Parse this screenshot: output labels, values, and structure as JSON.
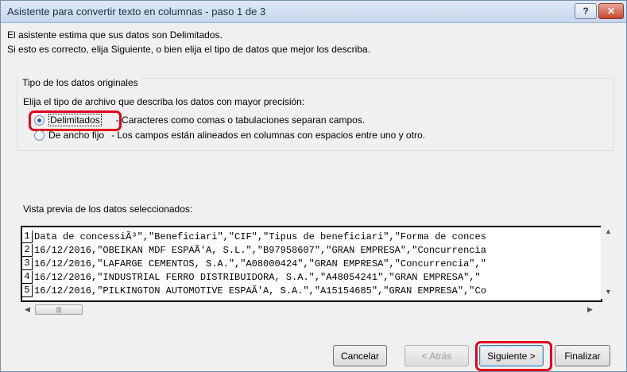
{
  "window": {
    "title": "Asistente para convertir texto en columnas - paso 1 de 3",
    "help_label": "?",
    "close_label": "✕"
  },
  "intro": {
    "line1": "El asistente estima que sus datos son Delimitados.",
    "line2": "Si esto es correcto, elija Siguiente, o bien elija el tipo de datos que mejor los describa."
  },
  "data_type": {
    "group_label": "Tipo de los datos originales",
    "instruction": "Elija el tipo de archivo que describa los datos con mayor precisión:",
    "options": [
      {
        "label": "Delimitados",
        "description": "- Caracteres como comas o tabulaciones separan campos.",
        "selected": true
      },
      {
        "label": "De ancho fijo",
        "description": "- Los campos están alineados en columnas con espacios entre uno y otro.",
        "selected": false
      }
    ]
  },
  "preview": {
    "label": "Vista previa de los datos seleccionados:",
    "rows": [
      {
        "num": "1",
        "text": "Data de concessiÃ³\",\"Beneficiari\",\"CIF\",\"Tipus de beneficiari\",\"Forma de conces"
      },
      {
        "num": "2",
        "text": "16/12/2016,\"OBEIKAN MDF ESPAÃ'A, S.L.\",\"B97958607\",\"GRAN EMPRESA\",\"Concurrencia"
      },
      {
        "num": "3",
        "text": "16/12/2016,\"LAFARGE CEMENTOS, S.A.\",\"A08000424\",\"GRAN EMPRESA\",\"Concurrencia\",\""
      },
      {
        "num": "4",
        "text": "16/12/2016,\"INDUSTRIAL FERRO DISTRIBUIDORA, S.A.\",\"A48054241\",\"GRAN EMPRESA\",\""
      },
      {
        "num": "5",
        "text": "16/12/2016,\"PILKINGTON AUTOMOTIVE ESPAÃ'A, S.A.\",\"A15154685\",\"GRAN EMPRESA\",\"Co"
      }
    ]
  },
  "buttons": {
    "cancel": "Cancelar",
    "back": "< Atrás",
    "next": "Siguiente >",
    "finish": "Finalizar"
  },
  "icons": {
    "scroll_up": "up-arrow-icon",
    "scroll_down": "down-arrow-icon",
    "scroll_left": "left-arrow-icon",
    "scroll_right": "right-arrow-icon"
  },
  "colors": {
    "highlight": "#e0001b",
    "radio_selected": "#1f5fb8"
  }
}
